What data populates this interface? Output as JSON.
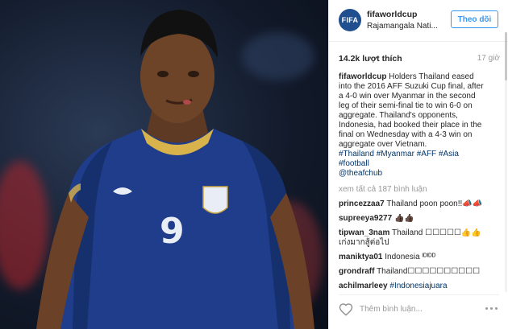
{
  "post": {
    "username": "fifaworldcup",
    "location": "Rajamangala Nati...",
    "avatar_text": "FIFA",
    "follow_label": "Theo dõi",
    "likes": "14.2k lượt thích",
    "time": "17 giờ",
    "caption_user": "fifaworldcup",
    "caption_lines": [
      "Holders Thailand eased",
      "into the 2016 AFF Suzuki Cup final, after",
      "a 4-0 win over Myanmar in the second",
      "leg of their semi-final tie to win 6-0 on",
      "aggregate. Thailand's opponents,",
      "Indonesia, had booked their place in the",
      "final on Wednesday with a 4-3 win on",
      "aggregate over Vietnam."
    ],
    "hashtags_line1": "#Thailand #Myanmar #AFF #Asia",
    "hashtags_line2": "#football",
    "mention": "@theafchub",
    "view_all": "xem tất cả 187 bình luận"
  },
  "comments": [
    {
      "user": "princezzaa7",
      "text": "Thailand poon poon!!📣📣"
    },
    {
      "user": "supreeya9277",
      "text": "👍🏿👍🏿"
    },
    {
      "user": "tipwan_3nam",
      "text": "Thailand ☐☐☐☐☐👍👍",
      "text2": "เก่งมากสู้ต่อไป"
    },
    {
      "user": "maniktya01",
      "text": "Indonesia ᴵᴰᴵᴰᴰ"
    },
    {
      "user": "grondraff",
      "text": "Thailand☐☐☐☐☐☐☐☐☐☐"
    },
    {
      "user": "achilmarleey",
      "text": "#Indonesiajuara"
    }
  ],
  "comment_placeholder": "Thêm bình luận...",
  "jersey": {
    "number": "9"
  },
  "colors": {
    "accent": "#3897f0",
    "link": "#003569",
    "jersey_blue": "#1f3d8a"
  },
  "icons": {
    "like": "heart-icon",
    "more": "more-options-icon"
  }
}
